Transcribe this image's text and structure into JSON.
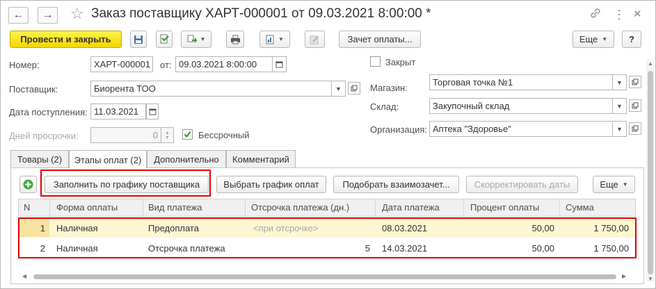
{
  "window": {
    "title": "Заказ поставщику ХАРТ-000001 от 09.03.2021 8:00:00 *"
  },
  "nav": {
    "back_glyph": "←",
    "forward_glyph": "→",
    "star_glyph": "☆",
    "link_glyph": "🔗",
    "menu_glyph": "⋮",
    "close_glyph": "✕"
  },
  "toolbar": {
    "post_close": "Провести и закрыть",
    "offset": "Зачет оплаты...",
    "more": "Еще",
    "help": "?"
  },
  "form": {
    "number_label": "Номер:",
    "number_value": "ХАРТ-000001",
    "from_label": "от:",
    "from_value": "09.03.2021  8:00:00",
    "supplier_label": "Поставщик:",
    "supplier_value": "Биорента ТОО",
    "arrival_label": "Дата поступления:",
    "arrival_value": "11.03.2021",
    "overdue_label": "Дней просрочки:",
    "overdue_value": "0",
    "unlimited_label": "Бессрочный",
    "closed_label": "Закрыт",
    "store_label": "Магазин:",
    "store_value": "Торговая точка №1",
    "warehouse_label": "Склад:",
    "warehouse_value": "Закупочный склад",
    "org_label": "Организация:",
    "org_value": "Аптека \"Здоровье\""
  },
  "tabs": [
    {
      "label": "Товары (2)"
    },
    {
      "label": "Этапы оплат (2)"
    },
    {
      "label": "Дополнительно"
    },
    {
      "label": "Комментарий"
    }
  ],
  "table_toolbar": {
    "fill": "Заполнить по графику поставщика",
    "choose": "Выбрать график оплат",
    "pick": "Подобрать взаимозачет...",
    "adjust": "Скорректировать даты",
    "more": "Еще"
  },
  "table": {
    "columns": [
      "N",
      "Форма оплаты",
      "Вид платежа",
      "Отсрочка платежа (дн.)",
      "Дата платежа",
      "Процент оплаты",
      "Сумма"
    ],
    "rows": [
      {
        "n": "1",
        "form": "Наличная",
        "type": "Предоплата",
        "delay": "<при отсрочке>",
        "date": "08.03.2021",
        "percent": "50,00",
        "sum": "1 750,00"
      },
      {
        "n": "2",
        "form": "Наличная",
        "type": "Отсрочка платежа",
        "delay": "5",
        "date": "14.03.2021",
        "percent": "50,00",
        "sum": "1 750,00"
      }
    ]
  },
  "colors": {
    "accent_yellow": "#f3d700",
    "highlight": "#e30000",
    "selected_row": "#fcf6d2",
    "add_icon": "#3fae3f",
    "checkbox_tick": "#2e8b2e"
  }
}
